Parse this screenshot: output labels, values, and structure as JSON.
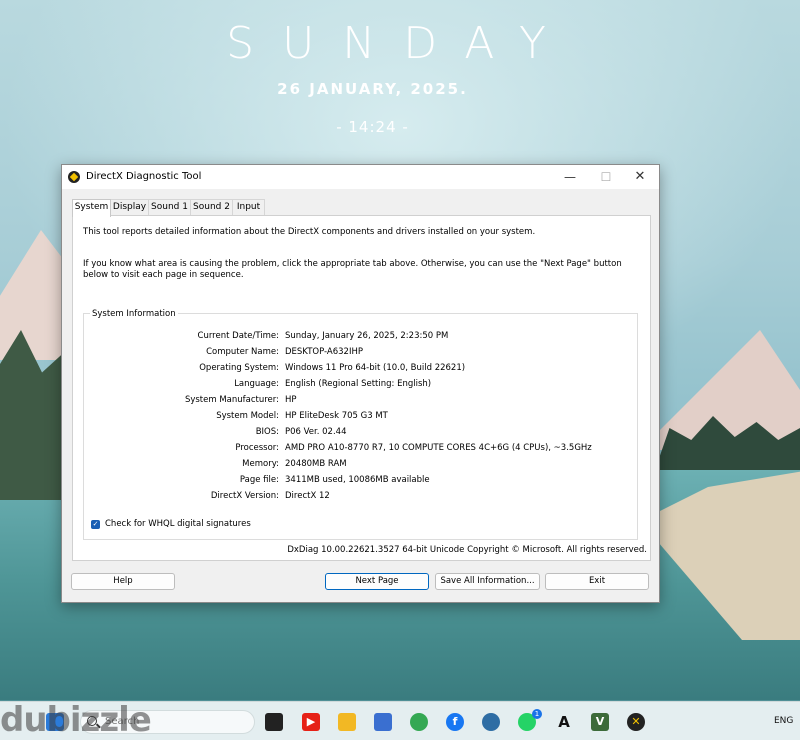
{
  "desktop": {
    "day": "SUNDAY",
    "date": "26 JANUARY, 2025.",
    "time": "- 14:24 -"
  },
  "window": {
    "title": "DirectX Diagnostic Tool",
    "controls": {
      "minimize": "—",
      "maximize": "☐",
      "close": "✕"
    },
    "tabs": [
      "System",
      "Display",
      "Sound 1",
      "Sound 2",
      "Input"
    ],
    "active_tab": "System",
    "intro_1": "This tool reports detailed information about the DirectX components and drivers installed on your system.",
    "intro_2": "If you know what area is causing the problem, click the appropriate tab above.  Otherwise, you can use the \"Next Page\" button below to visit each page in sequence.",
    "group_title": "System Information",
    "rows": [
      {
        "label": "Current Date/Time:",
        "value": "Sunday, January 26, 2025, 2:23:50 PM"
      },
      {
        "label": "Computer Name:",
        "value": "DESKTOP-A632IHP"
      },
      {
        "label": "Operating System:",
        "value": "Windows 11 Pro 64-bit (10.0, Build 22621)"
      },
      {
        "label": "Language:",
        "value": "English (Regional Setting: English)"
      },
      {
        "label": "System Manufacturer:",
        "value": "HP"
      },
      {
        "label": "System Model:",
        "value": "HP EliteDesk 705 G3 MT"
      },
      {
        "label": "BIOS:",
        "value": "P06 Ver. 02.44"
      },
      {
        "label": "Processor:",
        "value": "AMD PRO A10-8770 R7, 10 COMPUTE CORES 4C+6G     (4 CPUs), ~3.5GHz"
      },
      {
        "label": "Memory:",
        "value": "20480MB RAM"
      },
      {
        "label": "Page file:",
        "value": "3411MB used, 10086MB available"
      },
      {
        "label": "DirectX Version:",
        "value": "DirectX 12"
      }
    ],
    "whql_checkbox": {
      "label": "Check for WHQL digital signatures",
      "checked": true
    },
    "footer": "DxDiag 10.00.22621.3527 64-bit Unicode  Copyright © Microsoft. All rights reserved.",
    "buttons": {
      "help": "Help",
      "next_page": "Next Page",
      "save_all": "Save All Information...",
      "exit": "Exit"
    }
  },
  "taskbar": {
    "search_placeholder": "Search",
    "language": "ENG",
    "icons": [
      "windows-start-icon",
      "task-view-icon",
      "youtube-icon",
      "file-explorer-icon",
      "microsoft-store-icon",
      "chrome-icon",
      "facebook-icon",
      "globe-icon",
      "whatsapp-icon",
      "a-app-icon",
      "v-app-icon",
      "directx-icon"
    ],
    "whatsapp_badge": "1"
  },
  "watermark": "dubizzle"
}
